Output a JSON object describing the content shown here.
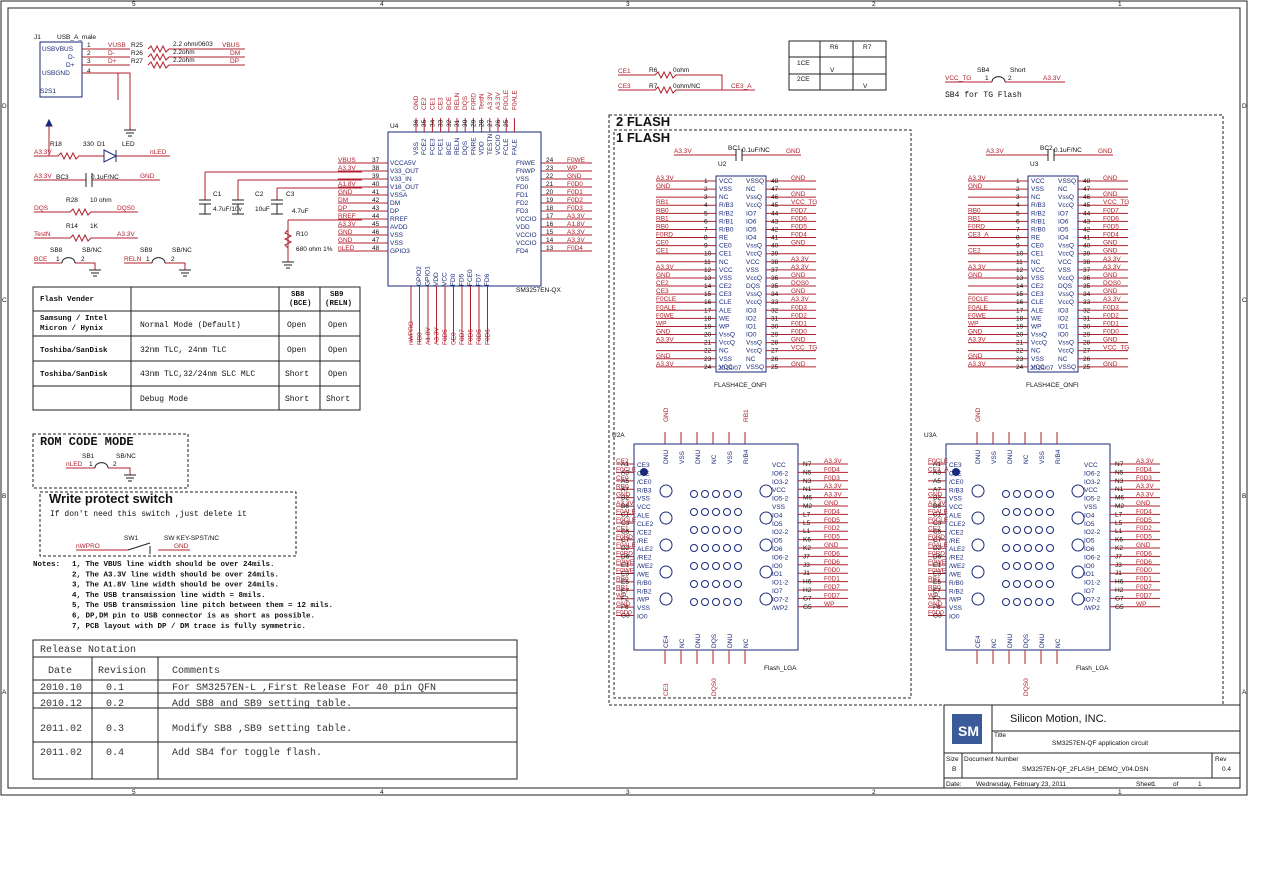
{
  "frame": {
    "col_labels": [
      "5",
      "4",
      "3",
      "2",
      "1"
    ],
    "row_labels": [
      "D",
      "C",
      "B",
      "A"
    ]
  },
  "usb": {
    "ref": "J1",
    "part": "USB_A_male",
    "pins": [
      "USBVBUS",
      "D-",
      "D+",
      "USBGND"
    ],
    "pin_nums": [
      "1",
      "2",
      "3",
      "4"
    ],
    "shield_pins": [
      "S2",
      "S1"
    ],
    "nets_left": [
      "VUSB",
      "D-",
      "D+"
    ],
    "resistors": [
      "R25",
      "R26",
      "R27"
    ],
    "values": [
      "2.2 ohm/0603",
      "2.2ohm",
      "2.2ohm"
    ],
    "nets_right": [
      "VBUS",
      "DM",
      "DP"
    ]
  },
  "led": {
    "net_left": "A3.3V",
    "r": "R18",
    "val": "330",
    "d": "D1",
    "label": "LED",
    "net_right": "nLED"
  },
  "bc3": {
    "net_left": "A3.3V",
    "ref": "BC3",
    "val": "0.1uF/NC",
    "net_right": "GND"
  },
  "r28": {
    "net_left": "DQS",
    "ref": "R28",
    "val": "10 ohm",
    "net_right": "DQS0"
  },
  "r14": {
    "net_left": "TestN",
    "ref": "R14",
    "val": "1K",
    "net_right": "A3.3V"
  },
  "sb8": {
    "ref": "SB8",
    "val": "SB/NC",
    "net": "BCE",
    "p1": "1",
    "p2": "2"
  },
  "sb9": {
    "ref": "SB9",
    "val": "SB/NC",
    "net": "RELN",
    "p1": "1",
    "p2": "2"
  },
  "u4": {
    "ref": "U4",
    "part": "SM3257EN-QX",
    "left_pins": [
      {
        "net": "VBUS",
        "num": "37",
        "name": "VCCA5V"
      },
      {
        "net": "A3.3V",
        "num": "38",
        "name": "V33_OUT"
      },
      {
        "net": "",
        "num": "39",
        "name": "V33_IN"
      },
      {
        "net": "A1.8V",
        "num": "40",
        "name": "V18_OUT"
      },
      {
        "net": "GND",
        "num": "41",
        "name": "VSSA"
      },
      {
        "net": "DM",
        "num": "42",
        "name": "DM"
      },
      {
        "net": "DP",
        "num": "43",
        "name": "DP"
      },
      {
        "net": "RREF",
        "num": "44",
        "name": "RREF"
      },
      {
        "net": "A3.3V",
        "num": "45",
        "name": "AVDD"
      },
      {
        "net": "GND",
        "num": "46",
        "name": "VSS"
      },
      {
        "net": "GND",
        "num": "47",
        "name": "VSS"
      },
      {
        "net": "nLED",
        "num": "48",
        "name": "GPIO3"
      }
    ],
    "right_pins": [
      {
        "name": "FNWE",
        "num": "24",
        "net": "F0WE"
      },
      {
        "name": "FNWP",
        "num": "23",
        "net": "WP"
      },
      {
        "name": "VSS",
        "num": "22",
        "net": "GND"
      },
      {
        "name": "FD0",
        "num": "21",
        "net": "F0D0"
      },
      {
        "name": "FD1",
        "num": "20",
        "net": "F0D1"
      },
      {
        "name": "FD2",
        "num": "19",
        "net": "F0D2"
      },
      {
        "name": "FD3",
        "num": "18",
        "net": "F0D3"
      },
      {
        "name": "VCCIO",
        "num": "17",
        "net": "A3.3V"
      },
      {
        "name": "VDD",
        "num": "16",
        "net": "A1.8V"
      },
      {
        "name": "VCCIO",
        "num": "15",
        "net": "A3.3V"
      },
      {
        "name": "VCCIO",
        "num": "14",
        "net": "A3.3V"
      },
      {
        "name": "FD4",
        "num": "13",
        "net": "F0D4"
      }
    ],
    "top_nets": [
      "GND",
      "CE2",
      "CE1",
      "CE3",
      "BCE",
      "RELN",
      "DQS",
      "F0RD",
      "TestN",
      "A3.3V",
      "A3.3V",
      "F0CLE",
      "F0ALE"
    ],
    "top_names": [
      "VSS",
      "FCE2",
      "FCE3",
      "FCE1",
      "BCE",
      "RELN",
      "DQS",
      "FNRE",
      "VDD",
      "TESTN",
      "VCCIO",
      "FCLE",
      "FALE"
    ],
    "top_nums": [
      "36",
      "35",
      "34",
      "33",
      "32",
      "31",
      "30",
      "29",
      "28",
      "27",
      "26",
      "25"
    ],
    "bottom_names": [
      "GPIO2",
      "GPIO1",
      "VDD",
      "VCC",
      "FD0",
      "FD5",
      "FCE0",
      "FD7",
      "FD6"
    ],
    "bottom_nets": [
      "nWPRO",
      "RB0",
      "A1.8V",
      "A3.3V",
      "F0D5",
      "CE0",
      "F0D7",
      "F0D6",
      "F0D5",
      "F0D6"
    ]
  },
  "caps": [
    {
      "ref": "C1",
      "val": "4.7uF/10v"
    },
    {
      "ref": "C2",
      "val": "10uF"
    },
    {
      "ref": "C3",
      "val": "4.7uF"
    }
  ],
  "r10": {
    "ref": "R10",
    "val": "680 ohm 1%"
  },
  "vender_table": {
    "headers": [
      "Flash Vender",
      "",
      "SB8\n(BCE)",
      "SB9\n(RELN)"
    ],
    "rows": [
      [
        "Samsung / Intel\nMicron / Hynix",
        "Normal Mode (Default)",
        "Open",
        "Open"
      ],
      [
        "Toshiba/SanDisk",
        "32nm TLC, 24nm TLC",
        "Open",
        "Open"
      ],
      [
        "Toshiba/SanDisk",
        "43nm TLC,32/24nm SLC MLC",
        "Short",
        "Open"
      ],
      [
        "",
        "Debug Mode",
        "Short",
        "Short"
      ]
    ]
  },
  "rom": {
    "title": "ROM CODE MODE",
    "ref": "SB1",
    "val": "SB/NC",
    "net": "nLED",
    "p1": "1",
    "p2": "2"
  },
  "wp": {
    "title": "Write protect switch",
    "note": "If don't need this switch ,just delete it",
    "ref": "SW1",
    "part": "SW KEY-SPST/NC",
    "net_left": "nWPRO",
    "net_right": "GND"
  },
  "notes": {
    "label": "Notes:",
    "items": [
      "1, The VBUS  line width should be over 24mils.",
      "2, The A3.3V line width should be over 24mils.",
      "3, The A1.8V line width should be over 24mils.",
      "4, The USB transmission line width = 8mils.",
      "5, The USB transmission line pitch between them = 12 mils.",
      "6, DP,DM pin to USB connector is as short as possible.",
      "7, PCB layout with DP / DM trace is fully symmetric."
    ]
  },
  "release": {
    "title": "Release Notation",
    "headers": [
      "Date",
      "Revision",
      "Comments"
    ],
    "rows": [
      [
        "2010.10",
        "0.1",
        "For SM3257EN-L ,First Release For 40 pin QFN"
      ],
      [
        "2010.12",
        "0.2",
        "Add SB8 and SB9 setting table."
      ],
      [
        "2011.02",
        "0.3",
        "Modify SB8 ,SB9 setting table."
      ],
      [
        "2011.02",
        "0.4",
        "Add SB4 for toggle flash."
      ]
    ]
  },
  "ce_section": {
    "r6": {
      "net_left": "CE1",
      "ref": "R6",
      "val": "0ohm"
    },
    "r7": {
      "net_left": "CE3",
      "ref": "R7",
      "val": "0ohm/NC",
      "net_right": "CE3_A"
    },
    "table": {
      "headers": [
        "",
        "R6",
        "R7"
      ],
      "rows": [
        [
          "1CE",
          "V",
          ""
        ],
        [
          "2CE",
          "",
          "V"
        ]
      ]
    }
  },
  "sb4": {
    "ref": "SB4",
    "val": "Short",
    "net_left": "VCC_TG",
    "net_right": "A3.3V",
    "p1": "1",
    "p2": "2",
    "note": "SB4 for TG Flash"
  },
  "flash_labels": [
    "2 FLASH",
    "1 FLASH"
  ],
  "u2": {
    "ref": "U2",
    "part": "FLASH4CE_ONFI",
    "date": "2010/07",
    "bc": {
      "ref": "BC1",
      "val": "0.1uF/NC",
      "net_left": "A3.3V",
      "net_right": "GND"
    },
    "left_nets": [
      "A3.3V",
      "GND",
      "",
      "RB1",
      "RB0",
      "RB1",
      "RB0",
      "F0RD",
      "CE0",
      "CE1",
      "",
      "A3.3V",
      "GND",
      "CE2",
      "CE3",
      "F0CLE",
      "F0ALE",
      "F0WE",
      "WP",
      "GND",
      "A3.3V",
      "",
      "GND",
      "A3.3V"
    ],
    "left_names": [
      "VCC",
      "VSS",
      "NC",
      "R/B3",
      "R/B2",
      "R/B1",
      "R/B0",
      "RE",
      "CE0",
      "CE1",
      "NC",
      "VCC",
      "VSS",
      "CE2",
      "CE3",
      "CLE",
      "ALE",
      "WE",
      "WP",
      "VssQ",
      "VccQ",
      "NC",
      "VSS",
      "VCC"
    ],
    "right_names": [
      "VSSQ",
      "NC",
      "VssQ",
      "VccQ",
      "IO7",
      "IO6",
      "IO5",
      "IO4",
      "VssQ",
      "VccQ",
      "VCC",
      "VSS",
      "VccQ",
      "DQS",
      "VssQ",
      "VccQ",
      "IO3",
      "IO2",
      "IO1",
      "IO0",
      "VssQ",
      "VccQ",
      "NC",
      "VSSQ"
    ],
    "right_nets": [
      "GND",
      "",
      "GND",
      "VCC_TG",
      "F0D7",
      "F0D6",
      "F0D5",
      "F0D4",
      "GND",
      "",
      "A3.3V",
      "A3.3V",
      "GND",
      "DQS0",
      "GND",
      "A3.3V",
      "F0D3",
      "F0D2",
      "F0D1",
      "F0D0",
      "GND",
      "VCC_TG",
      "",
      "GND"
    ]
  },
  "u3": {
    "ref": "U3",
    "part": "FLASH4CE_ONFI",
    "date": "2010/07",
    "bc": {
      "ref": "BC2",
      "val": "0.1uF/NC",
      "net_left": "A3.3V",
      "net_right": "GND"
    },
    "left_nets": [
      "A3.3V",
      "GND",
      "",
      "",
      "RB0",
      "RB1",
      "F0RD",
      "CE3_A",
      "",
      "CE2",
      "",
      "A3.3V",
      "GND",
      "",
      "",
      "F0CLE",
      "F0ALE",
      "F0WE",
      "WP",
      "GND",
      "A3.3V",
      "",
      "GND",
      "A3.3V"
    ],
    "left_names": [
      "VCC",
      "VSS",
      "NC",
      "R/B3",
      "R/B2",
      "R/B1",
      "R/B0",
      "RE",
      "CE0",
      "CE1",
      "NC",
      "VCC",
      "VSS",
      "CE2",
      "CE3",
      "CLE",
      "ALE",
      "WE",
      "WP",
      "VssQ",
      "VccQ",
      "NC",
      "VSS",
      "VCC"
    ],
    "right_names": [
      "VSSQ",
      "NC",
      "VssQ",
      "VccQ",
      "IO7",
      "IO6",
      "IO5",
      "IO4",
      "VssQ",
      "VccQ",
      "VCC",
      "VSS",
      "VccQ",
      "DQS",
      "VssQ",
      "VccQ",
      "IO3",
      "IO2",
      "IO1",
      "IO0",
      "VssQ",
      "VccQ",
      "NC",
      "VSSQ"
    ],
    "right_nets": [
      "GND",
      "",
      "GND",
      "VCC_TG",
      "F0D7",
      "F0D6",
      "F0D5",
      "F0D4",
      "GND",
      "GND",
      "A3.3V",
      "A3.3V",
      "GND",
      "DQS0",
      "GND",
      "A3.3V",
      "F0D3",
      "F0D2",
      "F0D1",
      "F0D0",
      "GND",
      "VCC_TG",
      "",
      "GND"
    ]
  },
  "u2a": {
    "ref": "U2A",
    "part": "Flash_LGA",
    "left_nets": [
      "CE2",
      "F0CLE",
      "CE0",
      "RB0",
      "GND",
      "A3.3V",
      "F0ALE",
      "F0CLE",
      "CE1",
      "F0RD",
      "F0ALE",
      "F0RD",
      "F0WE",
      "F0WE",
      "RB0",
      "RB1",
      "WP",
      "GND",
      "F0D0"
    ],
    "left_pins": [
      "A1",
      "A3",
      "A5",
      "A7",
      "B2",
      "B6",
      "C1",
      "C3",
      "C5",
      "C7",
      "D2",
      "D6",
      "E1",
      "E3",
      "E5",
      "E7",
      "F2",
      "F6",
      "G3"
    ],
    "left_names": [
      "CE3",
      "CLE",
      "/CE0",
      "R/B3",
      "VSS",
      "VCC",
      "ALE",
      "CLE2",
      "/CE2",
      "/RE",
      "ALE2",
      "/RE2",
      "/WE2",
      "/WE",
      "R/B0",
      "R/B2",
      "/WP",
      "VSS",
      "IO0"
    ],
    "right_names": [
      "VCC",
      "IO6-2",
      "IO3-2",
      "VCC",
      "IO5-2",
      "VSS",
      "IO4",
      "IO5",
      "IO2-2",
      "IO5",
      "IO6",
      "IO6-2",
      "IO0",
      "IO1",
      "IO1-2",
      "IO7",
      "IO7-2",
      "/WP2"
    ],
    "right_pins": [
      "N7",
      "N5",
      "N3",
      "N1",
      "M6",
      "M2",
      "L7",
      "L5",
      "L1",
      "K6",
      "K2",
      "J7",
      "J3",
      "J1",
      "H6",
      "H2",
      "G7",
      "G5"
    ],
    "right_nets": [
      "A3.3V",
      "F0D4",
      "F0D3",
      "A3.3V",
      "A3.3V",
      "GND",
      "F0D4",
      "F0D5",
      "F0D2",
      "F0D5",
      "GND",
      "F0D6",
      "F0D6",
      "F0D0",
      "F0D1",
      "F0D7",
      "F0D7",
      "WP"
    ],
    "top_names": [
      "DNU",
      "VSS",
      "DNU",
      "NC",
      "VSS",
      "R/B4"
    ],
    "top_nets": [
      "GND",
      "",
      "",
      "",
      "",
      "RB1"
    ],
    "bottom_names": [
      "CE4",
      "NC",
      "DNU",
      "DQS",
      "DNU",
      "NC"
    ],
    "bottom_nets": [
      "CE3",
      "",
      "",
      "DQS0",
      "",
      ""
    ]
  },
  "u3a": {
    "ref": "U3A",
    "part": "Flash_LGA",
    "left_nets": [
      "F0CLE",
      "CE3_A",
      "",
      "",
      "GND",
      "A3.3V",
      "F0ALE",
      "F0CLE",
      "CE2",
      "F0RD",
      "F0ALE",
      "F0RD",
      "F0WE",
      "F0WE",
      "RB1",
      "RB0",
      "WP",
      "GND",
      "F0D0"
    ],
    "left_pins": [
      "A1",
      "A3",
      "A5",
      "A7",
      "B2",
      "B6",
      "C1",
      "C3",
      "C5",
      "C7",
      "D2",
      "D6",
      "E1",
      "E3",
      "E5",
      "E7",
      "F2",
      "F6",
      "G3"
    ],
    "left_names": [
      "CE3",
      "CLE",
      "/CE0",
      "R/B3",
      "VSS",
      "VCC",
      "ALE",
      "CLE2",
      "/CE2",
      "/RE",
      "ALE2",
      "/RE2",
      "/WE2",
      "/WE",
      "R/B0",
      "R/B2",
      "/WP",
      "VSS",
      "IO0"
    ],
    "right_names": [
      "VCC",
      "IO6-2",
      "IO3-2",
      "VCC",
      "IO5-2",
      "VSS",
      "IO4",
      "IO5",
      "IO2-2",
      "IO5",
      "IO6",
      "IO6-2",
      "IO0",
      "IO1",
      "IO1-2",
      "IO7",
      "IO7-2",
      "/WP2"
    ],
    "right_pins": [
      "N7",
      "N5",
      "N3",
      "N1",
      "M6",
      "M2",
      "L7",
      "L5",
      "L1",
      "K6",
      "K2",
      "J7",
      "J3",
      "J1",
      "H6",
      "H2",
      "G7",
      "G5"
    ],
    "right_nets": [
      "A3.3V",
      "F0D4",
      "F0D3",
      "A3.3V",
      "A3.3V",
      "GND",
      "F0D4",
      "F0D5",
      "F0D2",
      "F0D5",
      "GND",
      "F0D6",
      "F0D6",
      "F0D0",
      "F0D1",
      "F0D7",
      "F0D7",
      "WP"
    ],
    "top_names": [
      "DNU",
      "VSS",
      "DNU",
      "NC",
      "VSS",
      "R/B4"
    ],
    "top_nets": [
      "GND",
      "",
      "",
      "",
      "",
      ""
    ],
    "bottom_names": [
      "CE4",
      "NC",
      "DNU",
      "DQS",
      "DNU",
      "NC"
    ],
    "bottom_nets": [
      "",
      "",
      "",
      "DQS0",
      "",
      ""
    ]
  },
  "title_block": {
    "company": "Silicon Motion, INC.",
    "title_label": "Title",
    "title": "SM3257EN-QF application circuit",
    "size_label": "Size",
    "size": "B",
    "docnum_label": "Document Number",
    "docnum": "SM3257EN-QF_2FLASH_DEMO_V04.DSN",
    "rev_label": "Rev",
    "rev": "0.4",
    "date_label": "Date:",
    "date": "Wednesday, February 23, 2011",
    "sheet_label": "Sheet",
    "sheet": "1",
    "of_label": "of",
    "of": "1"
  }
}
